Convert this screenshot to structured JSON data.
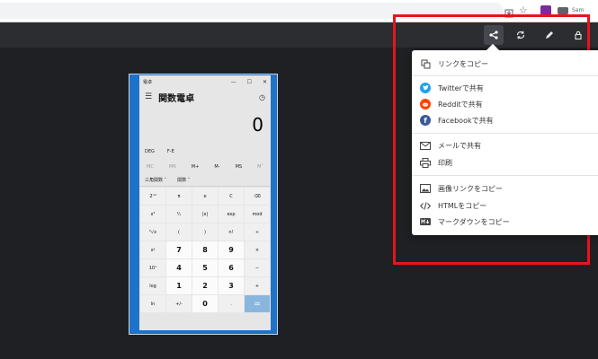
{
  "browser": {
    "profile_label": "Sam"
  },
  "toolbar": {
    "buttons": [
      "share-icon",
      "rotate-icon",
      "pencil-icon",
      "lock-icon"
    ]
  },
  "calculator": {
    "window_title": "電卓",
    "window_controls": [
      "—",
      "☐",
      "✕"
    ],
    "mode_title": "関数電卓",
    "display_value": "0",
    "angle_mode": "DEG",
    "fe_label": "F-E",
    "memory": [
      {
        "label": "MC",
        "enabled": false
      },
      {
        "label": "MR",
        "enabled": false
      },
      {
        "label": "M+",
        "enabled": true
      },
      {
        "label": "M-",
        "enabled": true
      },
      {
        "label": "MS",
        "enabled": true
      },
      {
        "label": "M˅",
        "enabled": false
      }
    ],
    "trig_label": "三角関数 ˅",
    "func_label": "関数 ˅",
    "keys": [
      "2ⁿᵈ",
      "π",
      "e",
      "C",
      "⌫",
      "x²",
      "¹⁄ₓ",
      "|x|",
      "exp",
      "mod",
      "²√x",
      "(",
      ")",
      "n!",
      "÷",
      "xʸ",
      "7",
      "8",
      "9",
      "×",
      "10ˣ",
      "4",
      "5",
      "6",
      "−",
      "log",
      "1",
      "2",
      "3",
      "+",
      "ln",
      "+/-",
      "0",
      ".",
      "="
    ]
  },
  "share_menu": {
    "items": [
      {
        "label": "リンクをコピー",
        "icon": "copy-icon"
      },
      {
        "label": "Twitterで共有",
        "icon": "twitter-icon",
        "color": "#1da1f2"
      },
      {
        "label": "Redditで共有",
        "icon": "reddit-icon",
        "color": "#ff4500"
      },
      {
        "label": "Facebookで共有",
        "icon": "facebook-icon",
        "color": "#3b5998"
      },
      {
        "label": "メールで共有",
        "icon": "mail-icon"
      },
      {
        "label": "印刷",
        "icon": "print-icon"
      },
      {
        "label": "画像リンクをコピー",
        "icon": "image-icon"
      },
      {
        "label": "HTMLをコピー",
        "icon": "code-icon"
      },
      {
        "label": "マークダウンをコピー",
        "icon": "markdown-icon"
      }
    ]
  },
  "colors": {
    "highlight": "#e8141c",
    "background": "#1f2023",
    "toolbar": "#2b2d31"
  }
}
